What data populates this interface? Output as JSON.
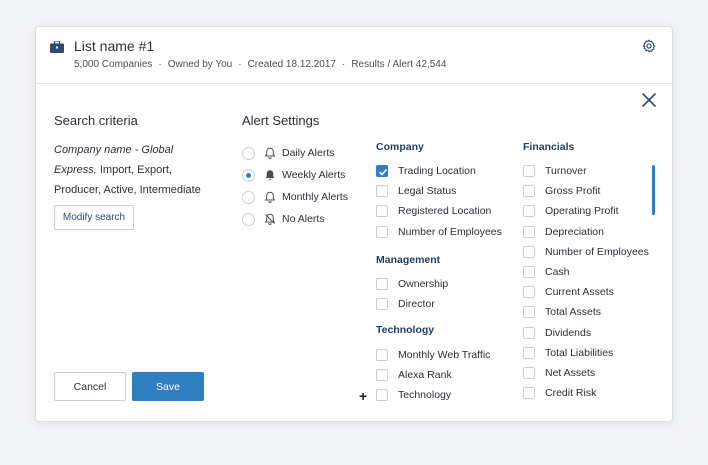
{
  "header": {
    "title": "List name #1",
    "companies": "5,000 Companies",
    "owner": "Owned by You",
    "created": "Created 18.12.2017",
    "results": "Results / Alert 42,544",
    "separator": "·"
  },
  "search_criteria": {
    "title": "Search criteria",
    "desc_italic": "Company name - Global Express,",
    "desc_rest": "Import, Export, Producer, Active, Intermediate",
    "modify_label": "Modify search"
  },
  "alert_settings": {
    "title": "Alert Settings",
    "options": [
      {
        "label": "Daily Alerts",
        "selected": false
      },
      {
        "label": "Weekly Alerts",
        "selected": true
      },
      {
        "label": "Monthly Alerts",
        "selected": false
      },
      {
        "label": "No Alerts",
        "selected": false
      }
    ]
  },
  "company": {
    "title": "Company",
    "items": [
      {
        "label": "Trading Location",
        "checked": true
      },
      {
        "label": "Legal Status",
        "checked": false
      },
      {
        "label": "Registered Location",
        "checked": false
      },
      {
        "label": "Number of Employees",
        "checked": false
      }
    ]
  },
  "management": {
    "title": "Management",
    "items": [
      {
        "label": "Ownership",
        "checked": false
      },
      {
        "label": "Director",
        "checked": false
      }
    ]
  },
  "technology": {
    "title": "Technology",
    "items": [
      {
        "label": "Monthly Web Traffic",
        "checked": false
      },
      {
        "label": "Alexa Rank",
        "checked": false
      },
      {
        "label": "Technology",
        "checked": false
      }
    ],
    "add_symbol": "+"
  },
  "financials": {
    "title": "Financials",
    "items": [
      {
        "label": "Turnover",
        "checked": false
      },
      {
        "label": "Gross Profit",
        "checked": false
      },
      {
        "label": "Operating Profit",
        "checked": false
      },
      {
        "label": "Depreciation",
        "checked": false
      },
      {
        "label": "Number of Employees",
        "checked": false
      },
      {
        "label": "Cash",
        "checked": false
      },
      {
        "label": "Current Assets",
        "checked": false
      },
      {
        "label": "Total Assets",
        "checked": false
      },
      {
        "label": "Dividends",
        "checked": false
      },
      {
        "label": "Total Liabilities",
        "checked": false
      },
      {
        "label": "Net Assets",
        "checked": false
      },
      {
        "label": "Credit Risk",
        "checked": false
      }
    ]
  },
  "footer": {
    "cancel_label": "Cancel",
    "save_label": "Save"
  },
  "colors": {
    "accent": "#2f7fc1",
    "section_title": "#1f3f66",
    "icon": "#2f4a6d"
  },
  "icons": [
    "briefcase-icon",
    "gear-icon",
    "close-icon",
    "bell-icon",
    "bell-filled-icon",
    "bell-off-icon",
    "checkmark-icon"
  ]
}
